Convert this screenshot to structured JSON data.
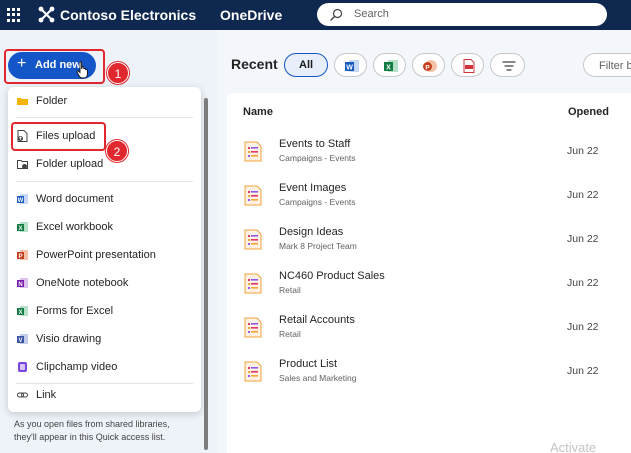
{
  "topbar": {
    "brand": "Contoso Electronics",
    "app": "OneDrive",
    "search_placeholder": "Search"
  },
  "left": {
    "add_new_label": "Add new",
    "menu": [
      {
        "label": "Folder",
        "icon": "folder-icon",
        "color": "#f4b400"
      },
      {
        "label": "Files upload",
        "icon": "file-upload-icon",
        "color": "#424242"
      },
      {
        "label": "Folder upload",
        "icon": "folder-upload-icon",
        "color": "#424242"
      },
      {
        "label": "Word document",
        "icon": "word-icon",
        "color": "#185abd"
      },
      {
        "label": "Excel workbook",
        "icon": "excel-icon",
        "color": "#107c41"
      },
      {
        "label": "PowerPoint presentation",
        "icon": "powerpoint-icon",
        "color": "#c43e1c"
      },
      {
        "label": "OneNote notebook",
        "icon": "onenote-icon",
        "color": "#7719aa"
      },
      {
        "label": "Forms for Excel",
        "icon": "forms-excel-icon",
        "color": "#107c41"
      },
      {
        "label": "Visio drawing",
        "icon": "visio-icon",
        "color": "#3955a3"
      },
      {
        "label": "Clipchamp video",
        "icon": "clipchamp-icon",
        "color": "#7a46e0"
      },
      {
        "label": "Link",
        "icon": "link-icon",
        "color": "#424242"
      }
    ],
    "hint": "As you open files from shared libraries, they'll appear in this Quick access list."
  },
  "annotations": {
    "step1": "1",
    "step2": "2",
    "highlight_color": "#e0282e"
  },
  "main": {
    "title": "Recent",
    "filters": [
      {
        "label": "All",
        "selected": true
      },
      {
        "icon": "word-icon"
      },
      {
        "icon": "excel-icon"
      },
      {
        "icon": "powerpoint-icon"
      },
      {
        "icon": "pdf-icon"
      },
      {
        "icon": "filter-icon"
      }
    ],
    "filter_placeholder": "Filter b",
    "columns": {
      "name": "Name",
      "opened": "Opened"
    },
    "files": [
      {
        "name": "Events to Staff",
        "location": "Campaigns - Events",
        "opened": "Jun 22"
      },
      {
        "name": "Event Images",
        "location": "Campaigns - Events",
        "opened": "Jun 22"
      },
      {
        "name": "Design Ideas",
        "location": "Mark 8 Project Team",
        "opened": "Jun 22"
      },
      {
        "name": "NC460 Product Sales",
        "location": "Retail",
        "opened": "Jun 22"
      },
      {
        "name": "Retail Accounts",
        "location": "Retail",
        "opened": "Jun 22"
      },
      {
        "name": "Product List",
        "location": "Sales and Marketing",
        "opened": "Jun 22"
      }
    ]
  },
  "watermark": "Activate"
}
